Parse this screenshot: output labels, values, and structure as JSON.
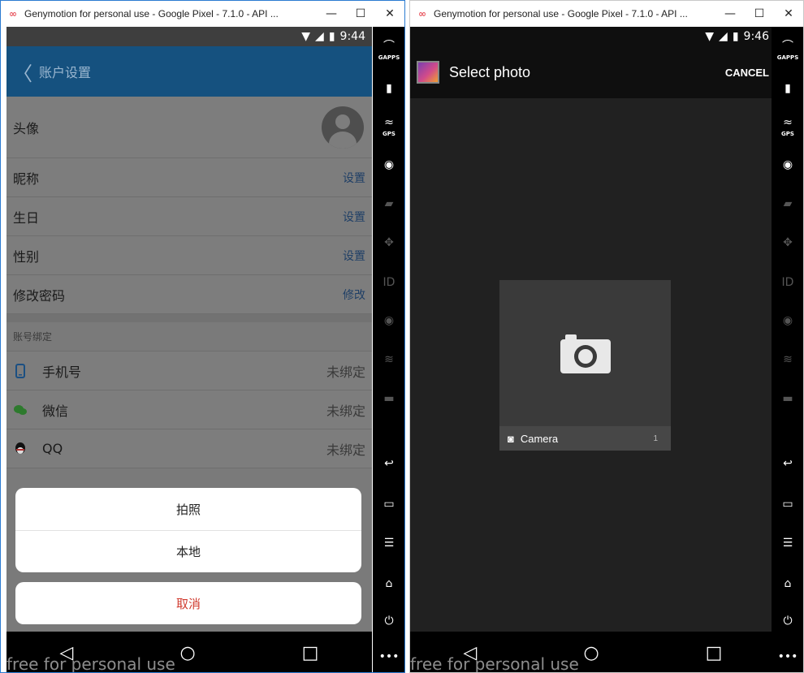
{
  "left_window": {
    "title": "Genymotion for personal use - Google Pixel - 7.1.0 - API ...",
    "window_buttons": {
      "minimize": "—",
      "maximize": "☐",
      "close": "✕"
    },
    "status": {
      "time": "9:44"
    },
    "appbar": {
      "back": "〈",
      "title": "账户设置"
    },
    "rows": [
      {
        "label": "头像"
      },
      {
        "label": "昵称",
        "value": "设置"
      },
      {
        "label": "生日",
        "value": "设置"
      },
      {
        "label": "性别",
        "value": "设置"
      },
      {
        "label": "修改密码",
        "value": "修改"
      }
    ],
    "section_title": "账号绑定",
    "bindings": [
      {
        "label": "手机号",
        "value": "未绑定",
        "icon": "phone-icon"
      },
      {
        "label": "微信",
        "value": "未绑定",
        "icon": "wechat-icon"
      },
      {
        "label": "QQ",
        "value": "未绑定",
        "icon": "qq-icon"
      }
    ],
    "sheet": {
      "option1": "拍照",
      "option2": "本地",
      "cancel": "取消"
    }
  },
  "right_window": {
    "title": "Genymotion for personal use - Google Pixel - 7.1.0 - API ...",
    "window_buttons": {
      "minimize": "—",
      "maximize": "☐",
      "close": "✕"
    },
    "status": {
      "time": "9:46"
    },
    "appbar": {
      "title": "Select photo",
      "cancel": "CANCEL"
    },
    "album": {
      "name": "Camera",
      "count": "1"
    }
  },
  "genymotion_toolbar": {
    "gapps": "GAPPS",
    "gps": "GPS",
    "id": "ID",
    "more": "•••"
  },
  "watermark": "free for personal use",
  "nav": {
    "back": "◁",
    "home": "○",
    "recents": "□"
  },
  "colors": {
    "appbar_blue": "#15517f",
    "cancel_red": "#d03a2e",
    "link_blue": "#1f3f66"
  }
}
